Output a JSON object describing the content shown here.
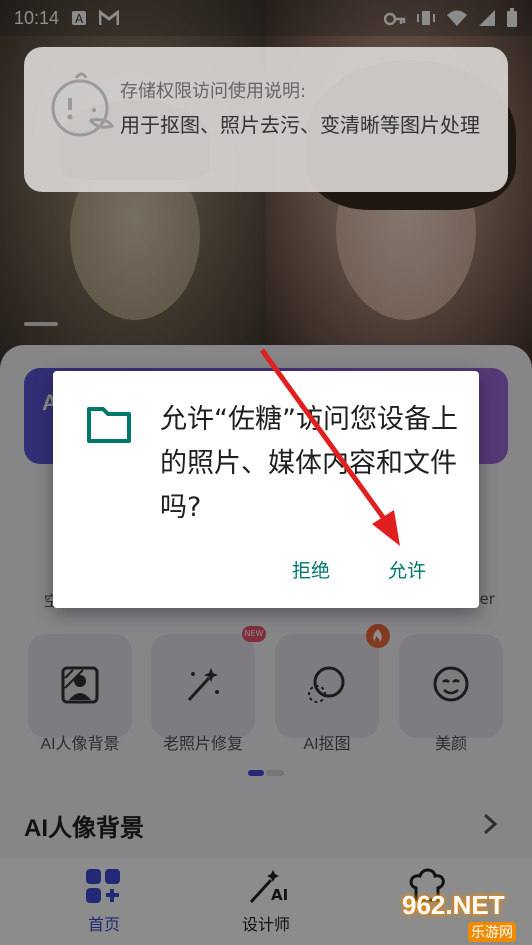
{
  "status_bar": {
    "time": "10:14"
  },
  "toast": {
    "title": "存储权限访问使用说明:",
    "body": "用于抠图、照片去污、变清晰等图片处理"
  },
  "dialog": {
    "message": "允许“佐糖”访问您设备上的照片、媒体内容和文件吗?",
    "deny_label": "拒绝",
    "allow_label": "允许"
  },
  "features": [
    {
      "label": "AI人像背景",
      "badge": ""
    },
    {
      "label": "老照片修复",
      "badge": "NEW"
    },
    {
      "label": "AI抠图",
      "badge": "hot"
    },
    {
      "label": "美颜",
      "badge": ""
    }
  ],
  "card_partial_texts": {
    "left": "A",
    "row2_left": "空",
    "row2_right": "der"
  },
  "section": {
    "title": "AI人像背景"
  },
  "bottom_nav": [
    {
      "label": "首页",
      "active": true
    },
    {
      "label": "设计师",
      "active": false
    },
    {
      "label": "",
      "active": false
    }
  ],
  "watermark": {
    "main": "962.NET",
    "sub": "乐游网"
  },
  "colors": {
    "accent": "#00776a",
    "card": "#6a5be0",
    "arrow": "#e02020"
  }
}
